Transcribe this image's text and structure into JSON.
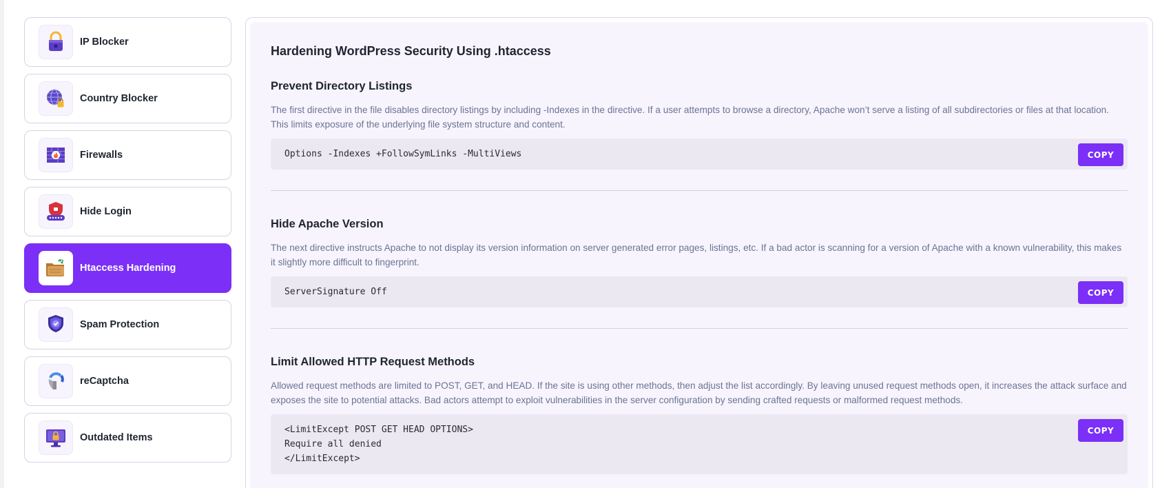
{
  "sidebar": {
    "items": [
      {
        "label": "IP Blocker",
        "icon": "padlock-icon",
        "active": false
      },
      {
        "label": "Country Blocker",
        "icon": "globe-lock-icon",
        "active": false
      },
      {
        "label": "Firewalls",
        "icon": "firewall-icon",
        "active": false
      },
      {
        "label": "Hide Login",
        "icon": "shield-login-icon",
        "active": false
      },
      {
        "label": "Htaccess Hardening",
        "icon": "folder-check-icon",
        "active": true
      },
      {
        "label": "Spam Protection",
        "icon": "shield-check-icon",
        "active": false
      },
      {
        "label": "reCaptcha",
        "icon": "recaptcha-icon",
        "active": false
      },
      {
        "label": "Outdated Items",
        "icon": "monitor-lock-icon",
        "active": false
      }
    ]
  },
  "main": {
    "title": "Hardening WordPress Security Using .htaccess",
    "copy_label": "COPY",
    "sections": [
      {
        "title": "Prevent Directory Listings",
        "description": "The first directive in the file disables directory listings by including -Indexes in the directive. If a user attempts to browse a directory, Apache won’t serve a listing of all subdirectories or files at that location. This limits exposure of the underlying file system structure and content.",
        "code": [
          "Options -Indexes +FollowSymLinks -MultiViews"
        ]
      },
      {
        "title": "Hide Apache Version",
        "description": "The next directive instructs Apache to not display its version information on server generated error pages, listings, etc. If a bad actor is scanning for a version of Apache with a known vulnerability, this makes it slightly more difficult to fingerprint.",
        "code": [
          "ServerSignature Off"
        ]
      },
      {
        "title": "Limit Allowed HTTP Request Methods",
        "description": "Allowed request methods are limited to POST, GET, and HEAD. If the site is using other methods, then adjust the list accordingly. By leaving unused request methods open, it increases the attack surface and exposes the site to potential attacks. Bad actors attempt to exploit vulnerabilities in the server configuration by sending crafted requests or malformed request methods.",
        "code": [
          "<LimitExcept POST GET HEAD OPTIONS>",
          "Require all denied",
          "</LimitExcept>"
        ]
      }
    ]
  },
  "colors": {
    "accent": "#7b2ff7",
    "panel_bg": "#f7f4fd",
    "code_bg": "#ece8f2",
    "desc_text": "#6b7393"
  }
}
